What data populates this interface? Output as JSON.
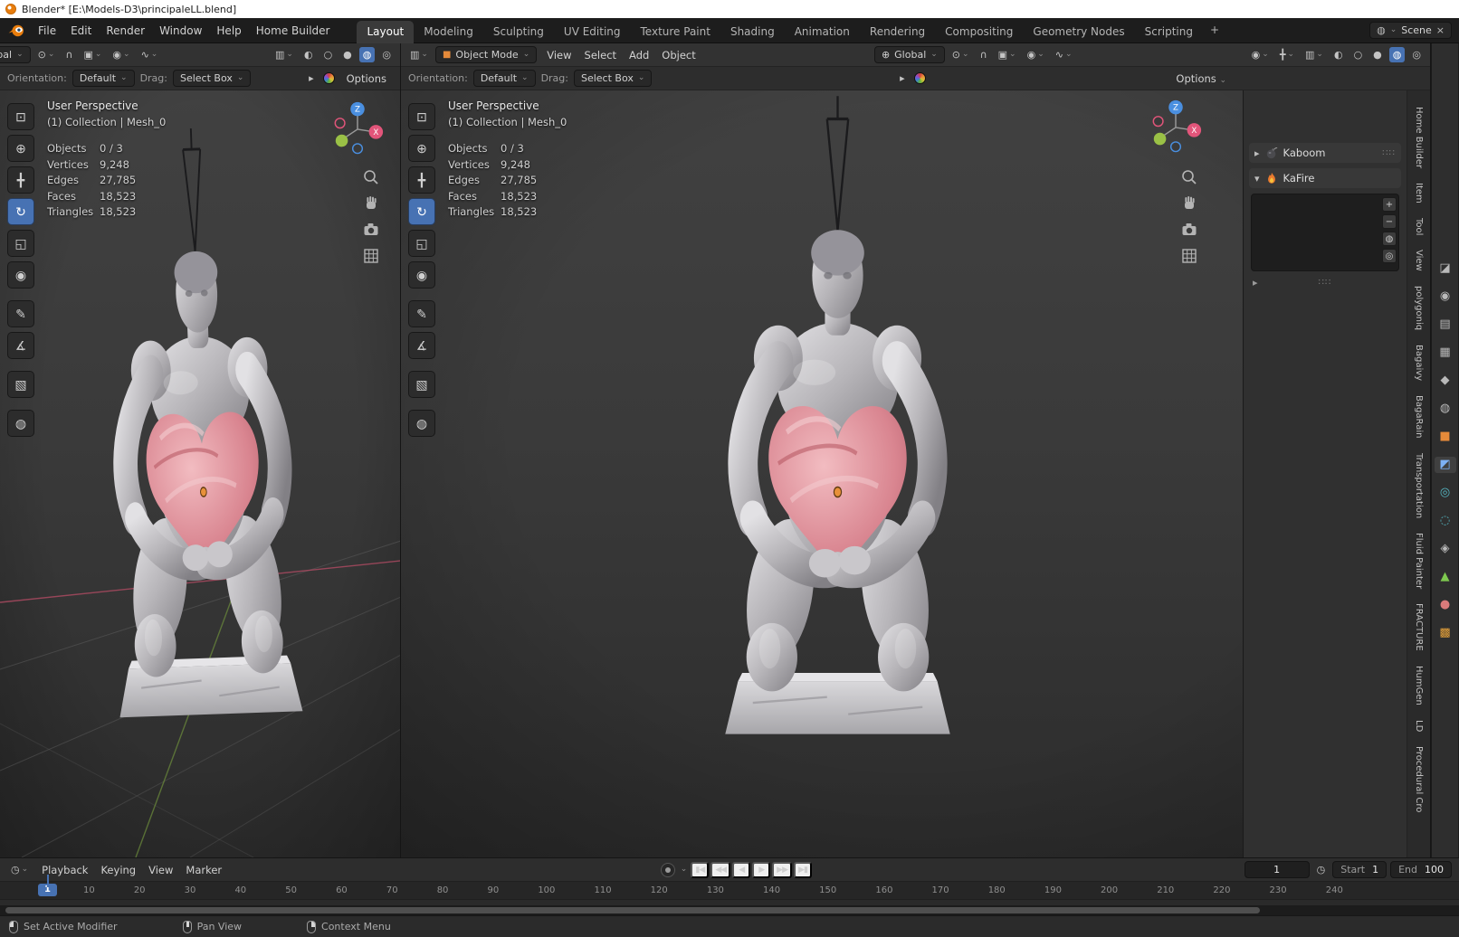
{
  "titlebar": {
    "title": "Blender* [E:\\Models-D3\\principaleLL.blend]"
  },
  "topbar": {
    "menus": [
      "File",
      "Edit",
      "Render",
      "Window",
      "Help",
      "Home Builder"
    ],
    "tabs": [
      "Layout",
      "Modeling",
      "Sculpting",
      "UV Editing",
      "Texture Paint",
      "Shading",
      "Animation",
      "Rendering",
      "Compositing",
      "Geometry Nodes",
      "Scripting"
    ],
    "active_tab": "Layout",
    "add_tab_label": "+",
    "scene_label": "Scene"
  },
  "viewport": {
    "editor_mode": "Object Mode",
    "menus": [
      "View",
      "Select",
      "Add",
      "Object"
    ],
    "orientation_global": "Global",
    "shading_mode": "material-preview",
    "tool_settings": {
      "orientation_label": "Orientation:",
      "orientation_value": "Default",
      "drag_label": "Drag:",
      "drag_value": "Select Box",
      "options_label": "Options"
    },
    "overlay": {
      "view_name": "User Perspective",
      "active_object": "(1) Collection | Mesh_0",
      "stats": [
        {
          "label": "Objects",
          "value": "0 / 3"
        },
        {
          "label": "Vertices",
          "value": "9,248"
        },
        {
          "label": "Edges",
          "value": "27,785"
        },
        {
          "label": "Faces",
          "value": "18,523"
        },
        {
          "label": "Triangles",
          "value": "18,523"
        }
      ]
    },
    "gizmo": {
      "z_label": "Z",
      "x_label": "X"
    },
    "toolbar": [
      {
        "name": "select-box",
        "glyph": "⊡"
      },
      {
        "name": "cursor",
        "glyph": "⊕"
      },
      {
        "name": "move",
        "glyph": "╋"
      },
      {
        "name": "rotate",
        "glyph": "↻"
      },
      {
        "name": "scale",
        "glyph": "◱"
      },
      {
        "name": "transform",
        "glyph": "◉"
      },
      {
        "name": "annotate",
        "glyph": "✎"
      },
      {
        "name": "measure",
        "glyph": "∡"
      },
      {
        "name": "add-cube",
        "glyph": "▧"
      },
      {
        "name": "material-ball",
        "glyph": "◍"
      }
    ],
    "active_tool": "rotate"
  },
  "sidebar": {
    "panels": [
      {
        "name": "Kaboom",
        "collapsed": true
      },
      {
        "name": "KaFire",
        "collapsed": false
      }
    ],
    "tabs": [
      "Home Builder",
      "Item",
      "Tool",
      "View",
      "polygoniq",
      "Bagaivy",
      "BagaRain",
      "Transportation",
      "Fluid Painter",
      "FRACTURE",
      "HumGen",
      "LD",
      "Procedural Cro"
    ]
  },
  "props_tabs": [
    {
      "name": "tool",
      "glyph": "◪"
    },
    {
      "name": "render",
      "glyph": "◉"
    },
    {
      "name": "output",
      "glyph": "▤"
    },
    {
      "name": "view-layer",
      "glyph": "▦"
    },
    {
      "name": "scene",
      "glyph": "◆"
    },
    {
      "name": "world",
      "glyph": "◍"
    },
    {
      "name": "object",
      "glyph": "■"
    },
    {
      "name": "modifiers",
      "glyph": "◩"
    },
    {
      "name": "particles",
      "glyph": "◎"
    },
    {
      "name": "physics",
      "glyph": "◌"
    },
    {
      "name": "constraints",
      "glyph": "◈"
    },
    {
      "name": "object-data",
      "glyph": "▲"
    },
    {
      "name": "material",
      "glyph": "●"
    },
    {
      "name": "texture",
      "glyph": "▩"
    }
  ],
  "timeline": {
    "menus": [
      "Playback",
      "Keying",
      "View",
      "Marker"
    ],
    "transport": [
      {
        "name": "jump-to-start",
        "glyph": "▮◀"
      },
      {
        "name": "previous-keyframe",
        "glyph": "◀◀"
      },
      {
        "name": "play-reverse",
        "glyph": "◀"
      },
      {
        "name": "play",
        "glyph": "▶"
      },
      {
        "name": "next-keyframe",
        "glyph": "▶▶"
      },
      {
        "name": "jump-to-end",
        "glyph": "▶▮"
      }
    ],
    "current_frame": "1",
    "frame_field_value": "1",
    "start_label": "Start",
    "start_value": "1",
    "end_label": "End",
    "end_value": "100",
    "ruler_marks": [
      "10",
      "20",
      "30",
      "40",
      "50",
      "60",
      "70",
      "80",
      "90",
      "100",
      "110",
      "120",
      "130",
      "140",
      "150",
      "160",
      "170",
      "180",
      "190",
      "200",
      "210",
      "220",
      "230",
      "240"
    ]
  },
  "statusbar": {
    "hints": [
      {
        "button": "left",
        "label": "Set Active Modifier"
      },
      {
        "button": "middle",
        "label": "Pan View"
      },
      {
        "button": "right",
        "label": "Context Menu"
      }
    ]
  },
  "icons": {
    "caret": "⌄",
    "chevron_right": "▸",
    "chevron_down": "▾",
    "editor_3d_viewport": "▥",
    "editor_timeline": "◷",
    "mode_cube": "■",
    "globe": "⊕",
    "pivot": "⊙",
    "magnet": "∩",
    "snap_target": "▣",
    "proportional": "◉",
    "falloff": "∿",
    "visibility": "◉",
    "gizmos": "╋",
    "overlays": "▥",
    "xray": "◐",
    "shade_wireframe": "○",
    "shade_solid": "●",
    "shade_material": "◍",
    "shade_rendered": "◎",
    "scene": "◍",
    "close": "×",
    "grip": "∷∷",
    "plus": "+",
    "minus": "−",
    "clock": "◷",
    "ball": "◍",
    "ring": "◎",
    "expand": "▸"
  },
  "colors": {
    "accent": "#4772b3",
    "axis_x": "#e2557a",
    "axis_y": "#9ac146",
    "axis_z": "#4a8fe0",
    "heart": "#d98590"
  }
}
